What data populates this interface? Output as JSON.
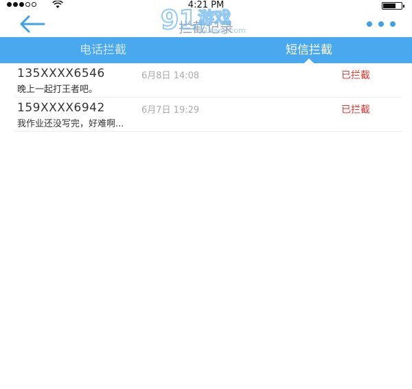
{
  "status_bar": {
    "time": "4:21 PM",
    "signal_icon": "cellular-signal-icon",
    "wifi_icon": "wifi-icon",
    "battery_icon": "battery-icon"
  },
  "nav": {
    "title": "拦截记录",
    "back_icon": "arrow-left-icon",
    "more_icon": "more-dots-icon",
    "watermark_text": "游戏",
    "watermark_subtext": "91danji.com",
    "watermark_number": "91"
  },
  "tabs": [
    {
      "label": "电话拦截",
      "active": false
    },
    {
      "label": "短信拦截",
      "active": true
    }
  ],
  "messages": [
    {
      "number": "135XXXX6546",
      "time": "6月8日 14:08",
      "status": "已拦截",
      "preview": "晚上一起打王者吧。"
    },
    {
      "number": "159XXXX6942",
      "time": "6月7日 19:29",
      "status": "已拦截",
      "preview": "我作业还没写完，好难啊..."
    }
  ],
  "colors": {
    "accent": "#4aa8ee",
    "icon_blue": "#3ea1ea",
    "status_red": "#e8352e"
  }
}
